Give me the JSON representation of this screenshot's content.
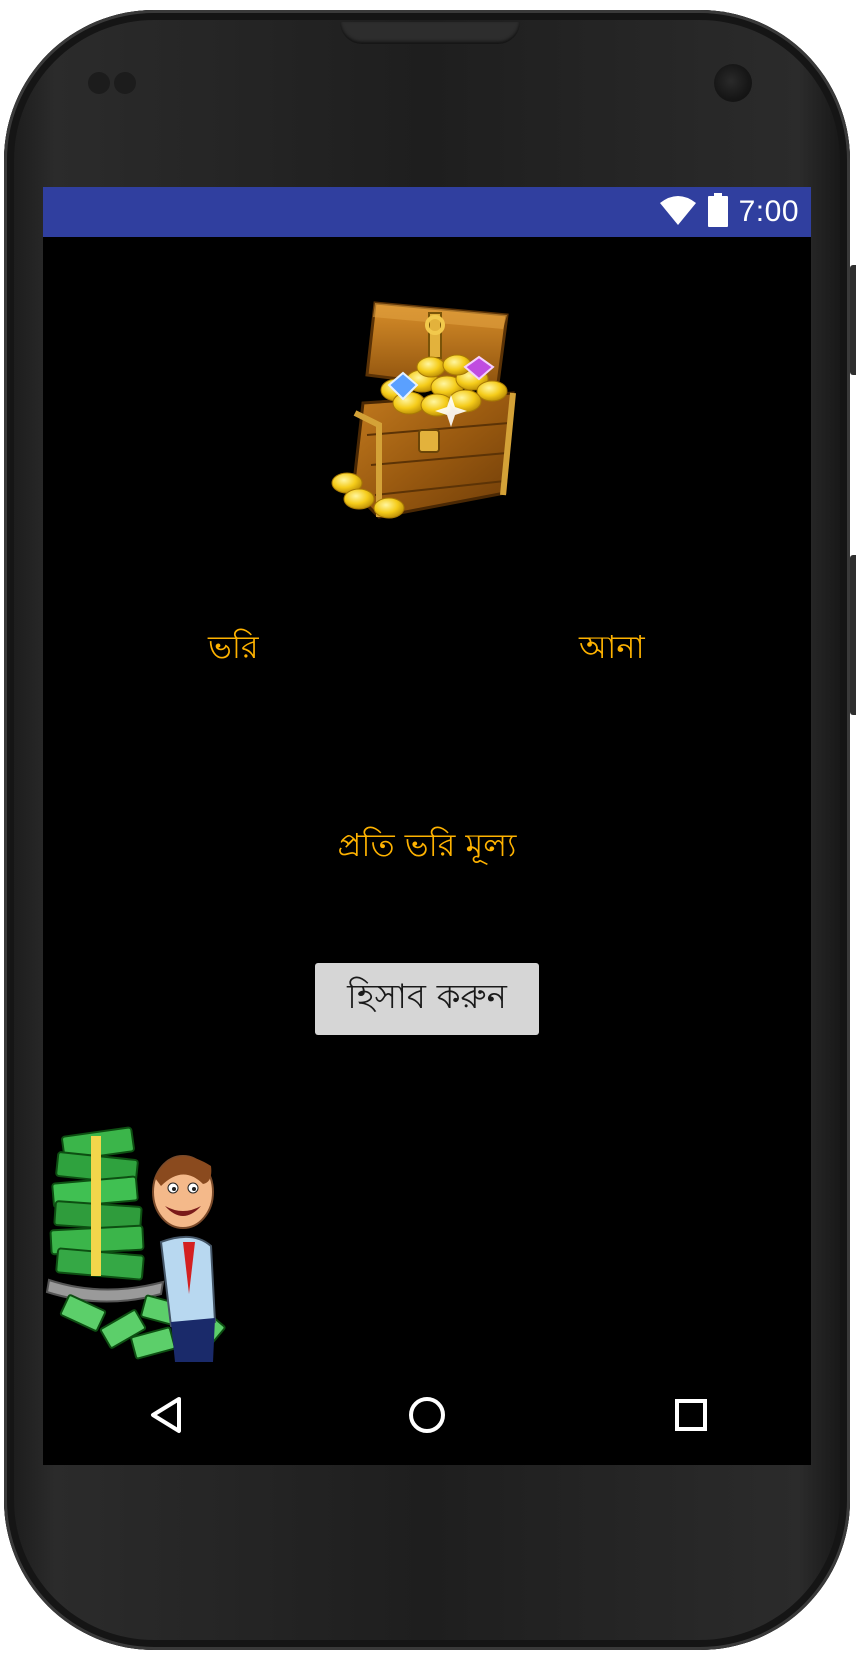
{
  "status_bar": {
    "time": "7:00",
    "icons": [
      "wifi-icon",
      "battery-icon"
    ],
    "color": "#303f9f"
  },
  "main": {
    "header_image": "treasure-chest-image",
    "labels": {
      "bhori": "ভরি",
      "ana": "আনা",
      "price_per_bhori": "প্রতি ভরি মূল্য"
    },
    "calculate_button": "হিসাব করুন",
    "footer_image": "money-man-image",
    "label_color": "#ffb300",
    "background": "#000000"
  },
  "nav_bar": {
    "buttons": [
      "back-icon",
      "home-icon",
      "recents-icon"
    ]
  }
}
